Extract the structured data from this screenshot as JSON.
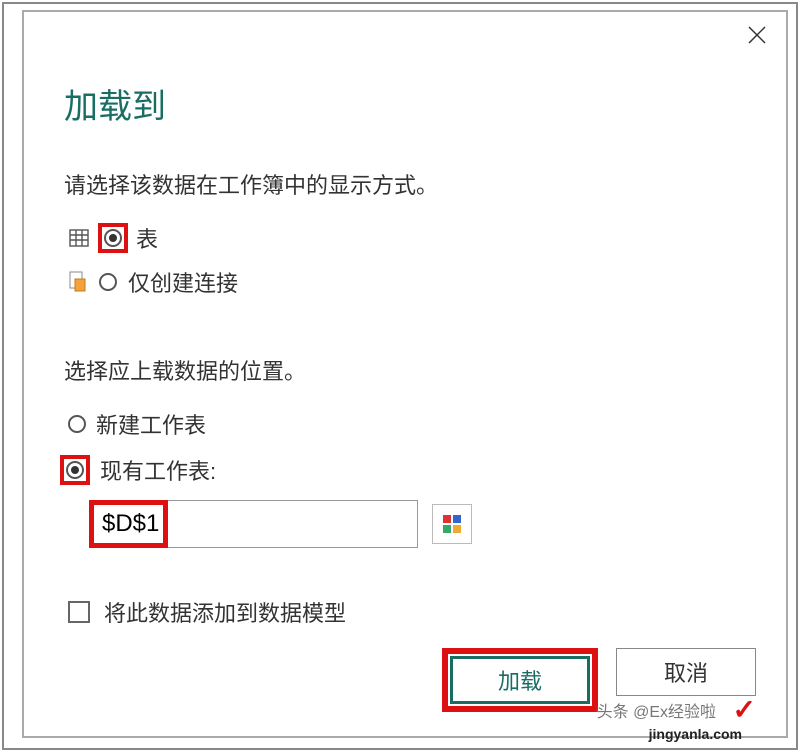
{
  "dialog": {
    "title": "加载到",
    "prompt1": "请选择该数据在工作簿中的显示方式。",
    "display_options": {
      "table": "表",
      "connection_only": "仅创建连接"
    },
    "prompt2": "选择应上载数据的位置。",
    "location_options": {
      "new_sheet": "新建工作表",
      "existing_sheet": "现有工作表:"
    },
    "range_value": "$D$1",
    "add_to_model": "将此数据添加到数据模型",
    "buttons": {
      "load": "加载",
      "cancel": "取消"
    }
  },
  "watermarks": {
    "line1": "头条 @Ex经验啦",
    "line2": "jingyanla.com"
  }
}
